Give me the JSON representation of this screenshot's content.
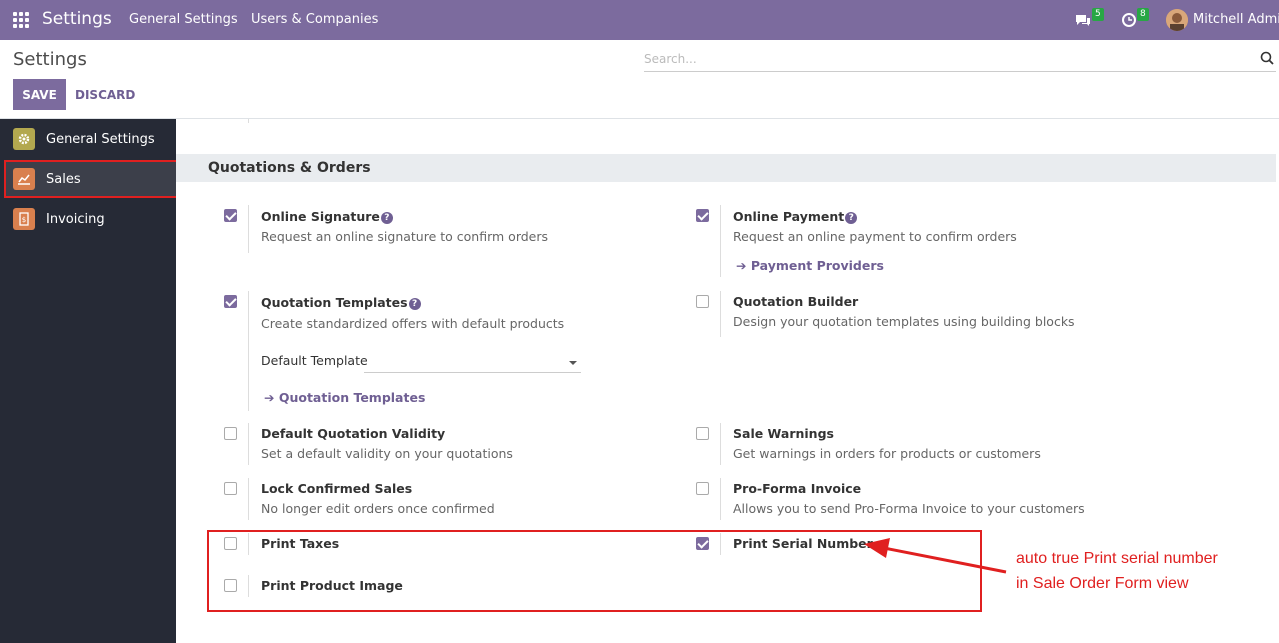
{
  "topbar": {
    "brand": "Settings",
    "nav": [
      "General Settings",
      "Users & Companies"
    ],
    "chat_count": "5",
    "activity_count": "8",
    "user": "Mitchell Admin"
  },
  "control": {
    "title": "Settings",
    "search_placeholder": "Search...",
    "save": "SAVE",
    "discard": "DISCARD"
  },
  "sidebar": [
    {
      "label": "General Settings",
      "color": "#b3a84f"
    },
    {
      "label": "Sales",
      "color": "#d9804e"
    },
    {
      "label": "Invoicing",
      "color": "#d9804e"
    }
  ],
  "section": {
    "title": "Quotations & Orders",
    "settings": {
      "online_signature": {
        "title": "Online Signature",
        "desc": "Request an online signature to confirm orders",
        "checked": true
      },
      "online_payment": {
        "title": "Online Payment",
        "desc": "Request an online payment to confirm orders",
        "checked": true,
        "link": "Payment Providers"
      },
      "quotation_templates": {
        "title": "Quotation Templates",
        "desc": "Create standardized offers with default products",
        "checked": true,
        "field_label": "Default Template",
        "link": "Quotation Templates"
      },
      "quotation_builder": {
        "title": "Quotation Builder",
        "desc": "Design your quotation templates using building blocks",
        "checked": false
      },
      "default_validity": {
        "title": "Default Quotation Validity",
        "desc": "Set a default validity on your quotations",
        "checked": false
      },
      "sale_warnings": {
        "title": "Sale Warnings",
        "desc": "Get warnings in orders for products or customers",
        "checked": false
      },
      "lock_confirmed": {
        "title": "Lock Confirmed Sales",
        "desc": "No longer edit orders once confirmed",
        "checked": false
      },
      "proforma": {
        "title": "Pro-Forma Invoice",
        "desc": "Allows you to send Pro-Forma Invoice to your customers",
        "checked": false
      },
      "print_taxes": {
        "title": "Print Taxes",
        "checked": false
      },
      "print_serial": {
        "title": "Print Serial Number",
        "checked": true
      },
      "print_image": {
        "title": "Print Product Image",
        "checked": false
      }
    }
  },
  "annotation": {
    "line1": "auto true Print serial number",
    "line2": "in Sale Order Form view",
    "color": "#e02020"
  }
}
